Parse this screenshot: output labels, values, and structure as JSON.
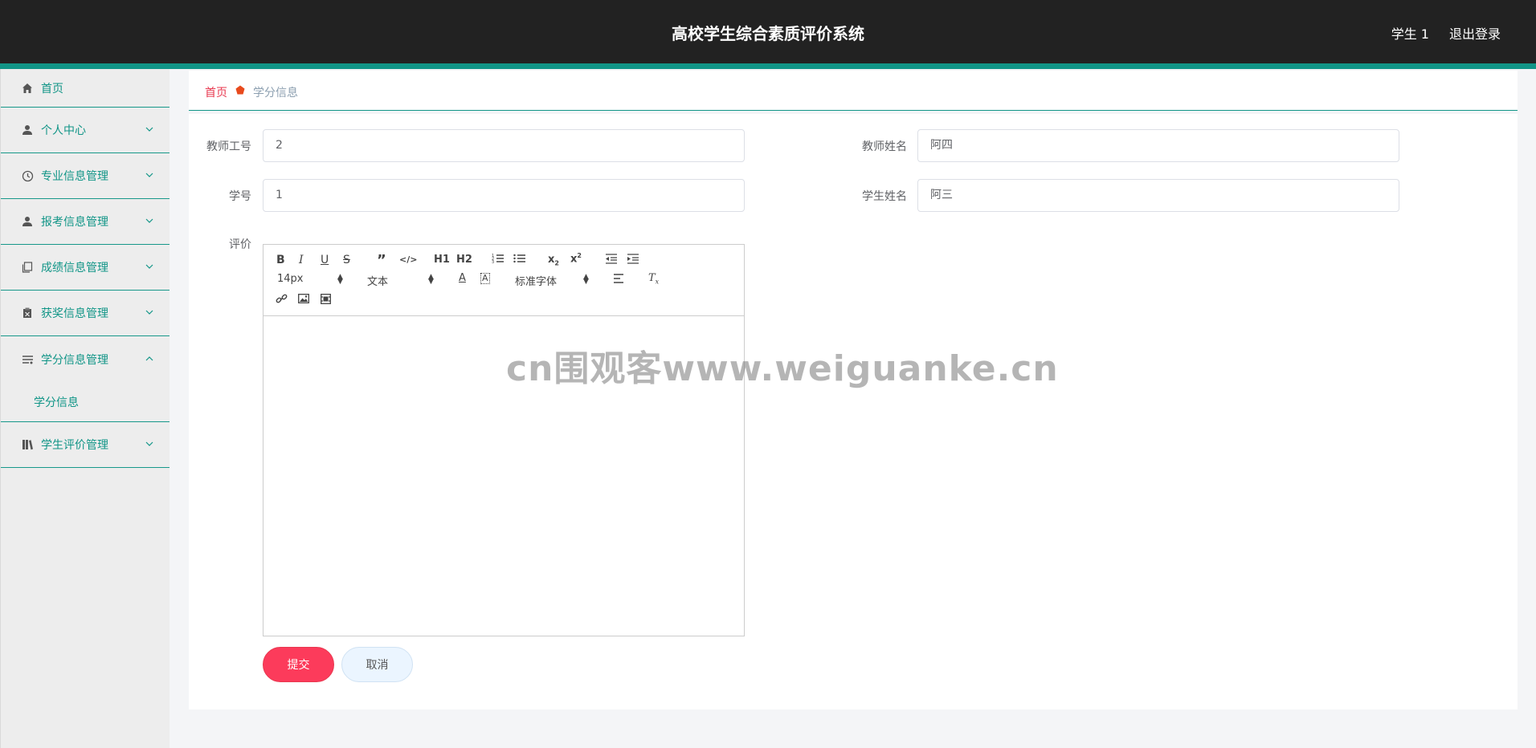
{
  "header": {
    "title": "高校学生综合素质评价系统",
    "user": "学生 1",
    "logout": "退出登录"
  },
  "sidebar": {
    "items": [
      {
        "label": "首页",
        "icon": "home-icon"
      },
      {
        "label": "个人中心",
        "icon": "user-icon"
      },
      {
        "label": "专业信息管理",
        "icon": "clock-icon"
      },
      {
        "label": "报考信息管理",
        "icon": "user-icon"
      },
      {
        "label": "成绩信息管理",
        "icon": "copy-icon"
      },
      {
        "label": "获奖信息管理",
        "icon": "clipboard-icon"
      },
      {
        "label": "学分信息管理",
        "icon": "list-icon",
        "expanded": true
      },
      {
        "label": "学生评价管理",
        "icon": "book-icon"
      }
    ],
    "subitem": "学分信息"
  },
  "breadcrumb": {
    "home": "首页",
    "current": "学分信息"
  },
  "form": {
    "teacher_id_label": "教师工号",
    "teacher_id_value": "2",
    "teacher_name_label": "教师姓名",
    "teacher_name_value": "阿四",
    "student_no_label": "学号",
    "student_no_value": "1",
    "student_name_label": "学生姓名",
    "student_name_value": "阿三",
    "review_label": "评价"
  },
  "editor": {
    "font_size": "14px",
    "header_select": "文本",
    "font_family": "标准字体",
    "h1": "H1",
    "h2": "H2"
  },
  "buttons": {
    "submit": "提交",
    "cancel": "取消"
  },
  "watermark": "cn围观客www.weiguanke.cn",
  "colors": {
    "header_bg": "#222222",
    "accent": "#119587",
    "submit": "#fc3b5b",
    "crumb_home": "#e8384f"
  }
}
